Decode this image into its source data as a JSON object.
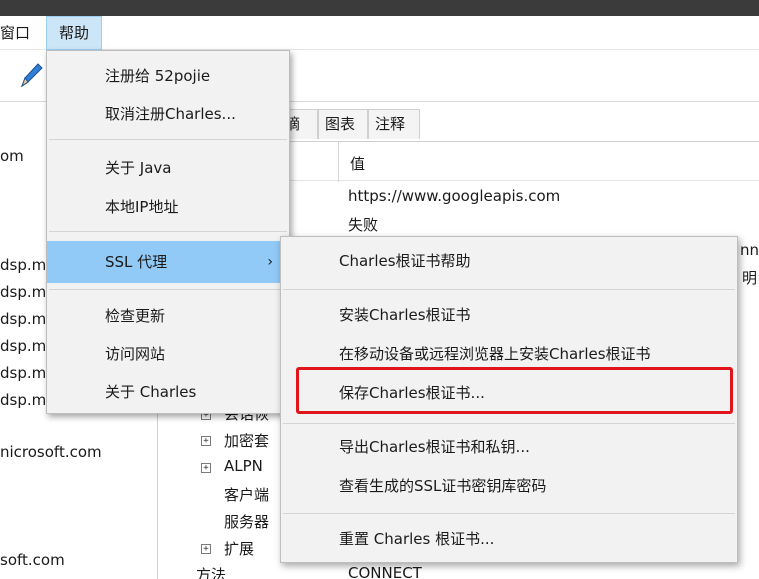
{
  "menubar": {
    "items": [
      "窗口",
      "帮助"
    ]
  },
  "left_list": {
    "rows": [
      "om",
      "dsp.m",
      "dsp.m",
      "dsp.m",
      "dsp.m",
      "dsp.m",
      "dsp.m",
      "nicrosoft.com",
      "soft.com"
    ]
  },
  "tabs": [
    "摘要",
    "图表",
    "注释"
  ],
  "table": {
    "value_header": "值",
    "value_rows": [
      "https://www.googleapis.com",
      "失败"
    ],
    "tree_items": [
      "会话恢",
      "加密套",
      "ALPN",
      "客户端",
      "服务器",
      "扩展",
      "方法"
    ],
    "method_value": "CONNECT",
    "edge_texts": [
      "nne",
      "明"
    ]
  },
  "help_menu": {
    "items": [
      "注册给 52pojie",
      "取消注册Charles...",
      "关于 Java",
      "本地IP地址",
      "SSL 代理",
      "检查更新",
      "访问网站",
      "关于 Charles"
    ],
    "submenu_arrow": "›"
  },
  "ssl_submenu": {
    "items": [
      "Charles根证书帮助",
      "安装Charles根证书",
      "在移动设备或远程浏览器上安装Charles根证书",
      "保存Charles根证书...",
      "导出Charles根证书和私钥...",
      "查看生成的SSL证书密钥库密码",
      "重置 Charles 根证书..."
    ],
    "highlighted_item": "保存Charles根证书..."
  },
  "colors": {
    "menu_bg": "#f2f2f2",
    "highlight": "#91c9f7",
    "annotation_red": "#e0141b",
    "titlebar": "#3b3b3b"
  }
}
